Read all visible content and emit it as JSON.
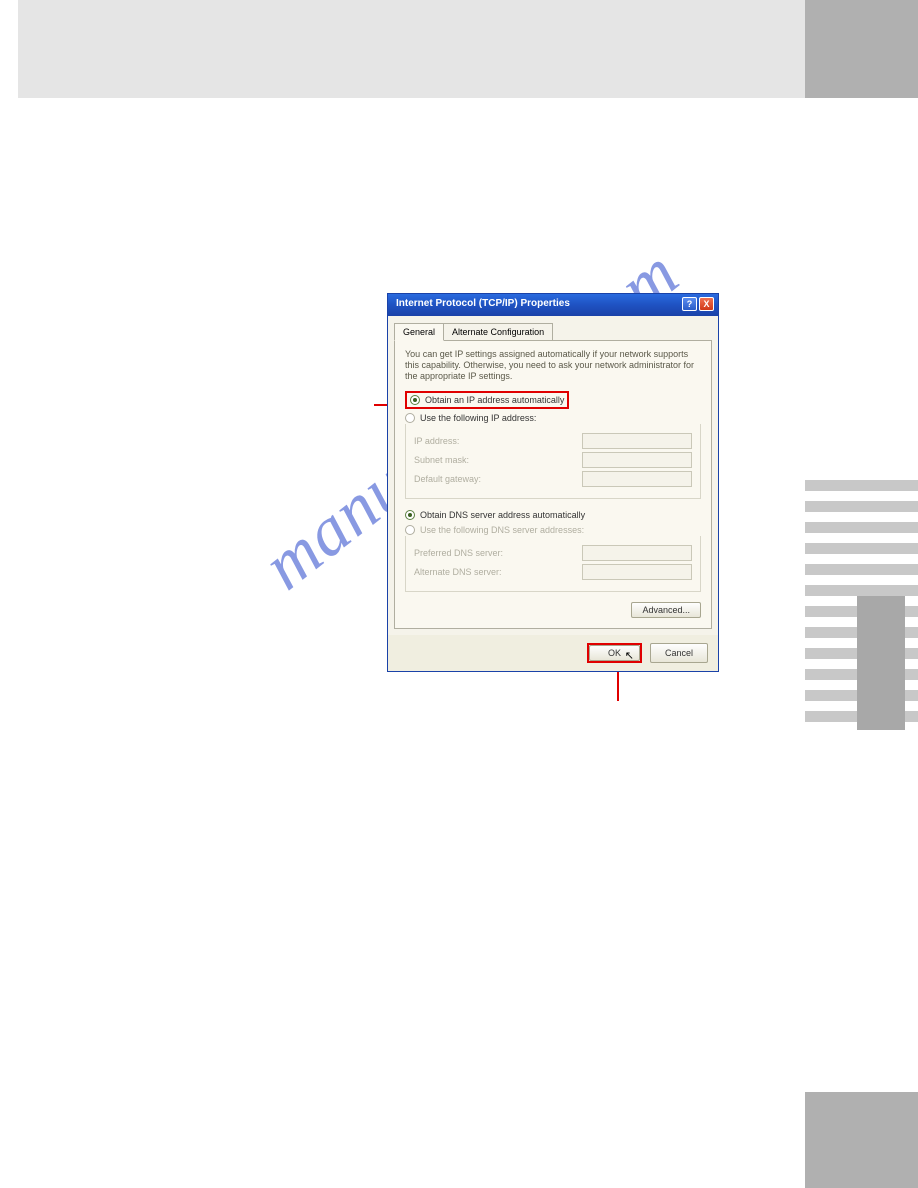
{
  "watermark_text": "manualshive.com",
  "dialog": {
    "title": "Internet Protocol (TCP/IP) Properties",
    "tabs": {
      "general": "General",
      "alternate": "Alternate Configuration"
    },
    "description": "You can get IP settings assigned automatically if your network supports this capability. Otherwise, you need to ask your network administrator for the appropriate IP settings.",
    "ip_section": {
      "opt_auto": "Obtain an IP address automatically",
      "opt_manual": "Use the following IP address:",
      "fields": {
        "ip": "IP address:",
        "subnet": "Subnet mask:",
        "gateway": "Default gateway:"
      }
    },
    "dns_section": {
      "opt_auto": "Obtain DNS server address automatically",
      "opt_manual": "Use the following DNS server addresses:",
      "fields": {
        "preferred": "Preferred DNS server:",
        "alternate": "Alternate DNS server:"
      }
    },
    "buttons": {
      "advanced": "Advanced...",
      "ok": "OK",
      "cancel": "Cancel"
    },
    "winbtn_help": "?",
    "winbtn_close": "X"
  }
}
